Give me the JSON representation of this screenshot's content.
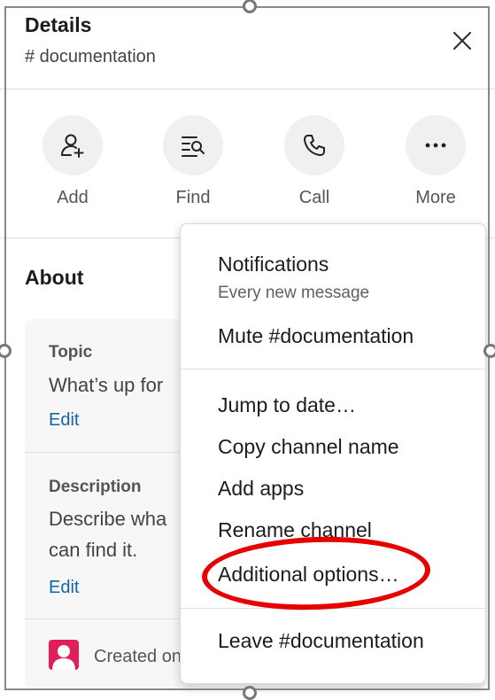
{
  "header": {
    "title": "Details",
    "channel": "# documentation"
  },
  "actions": [
    {
      "label": "Add",
      "icon": "add-person-icon"
    },
    {
      "label": "Find",
      "icon": "find-icon"
    },
    {
      "label": "Call",
      "icon": "phone-icon"
    },
    {
      "label": "More",
      "icon": "more-icon"
    }
  ],
  "about": {
    "title": "About",
    "topic_label": "Topic",
    "topic_value": "What’s up for",
    "description_label": "Description",
    "description_line1": "Describe wha",
    "description_line2": "can find it.",
    "edit_label": "Edit",
    "created_text": "Created on"
  },
  "menu": {
    "notifications": "Notifications",
    "notifications_sub": "Every new message",
    "mute": "Mute #documentation",
    "jump": "Jump to date…",
    "copy": "Copy channel name",
    "add_apps": "Add apps",
    "rename": "Rename channel",
    "additional": "Additional options…",
    "leave": "Leave #documentation"
  },
  "colors": {
    "link": "#1264a3",
    "highlight": "#e60000",
    "avatar": "#e01e5a"
  }
}
